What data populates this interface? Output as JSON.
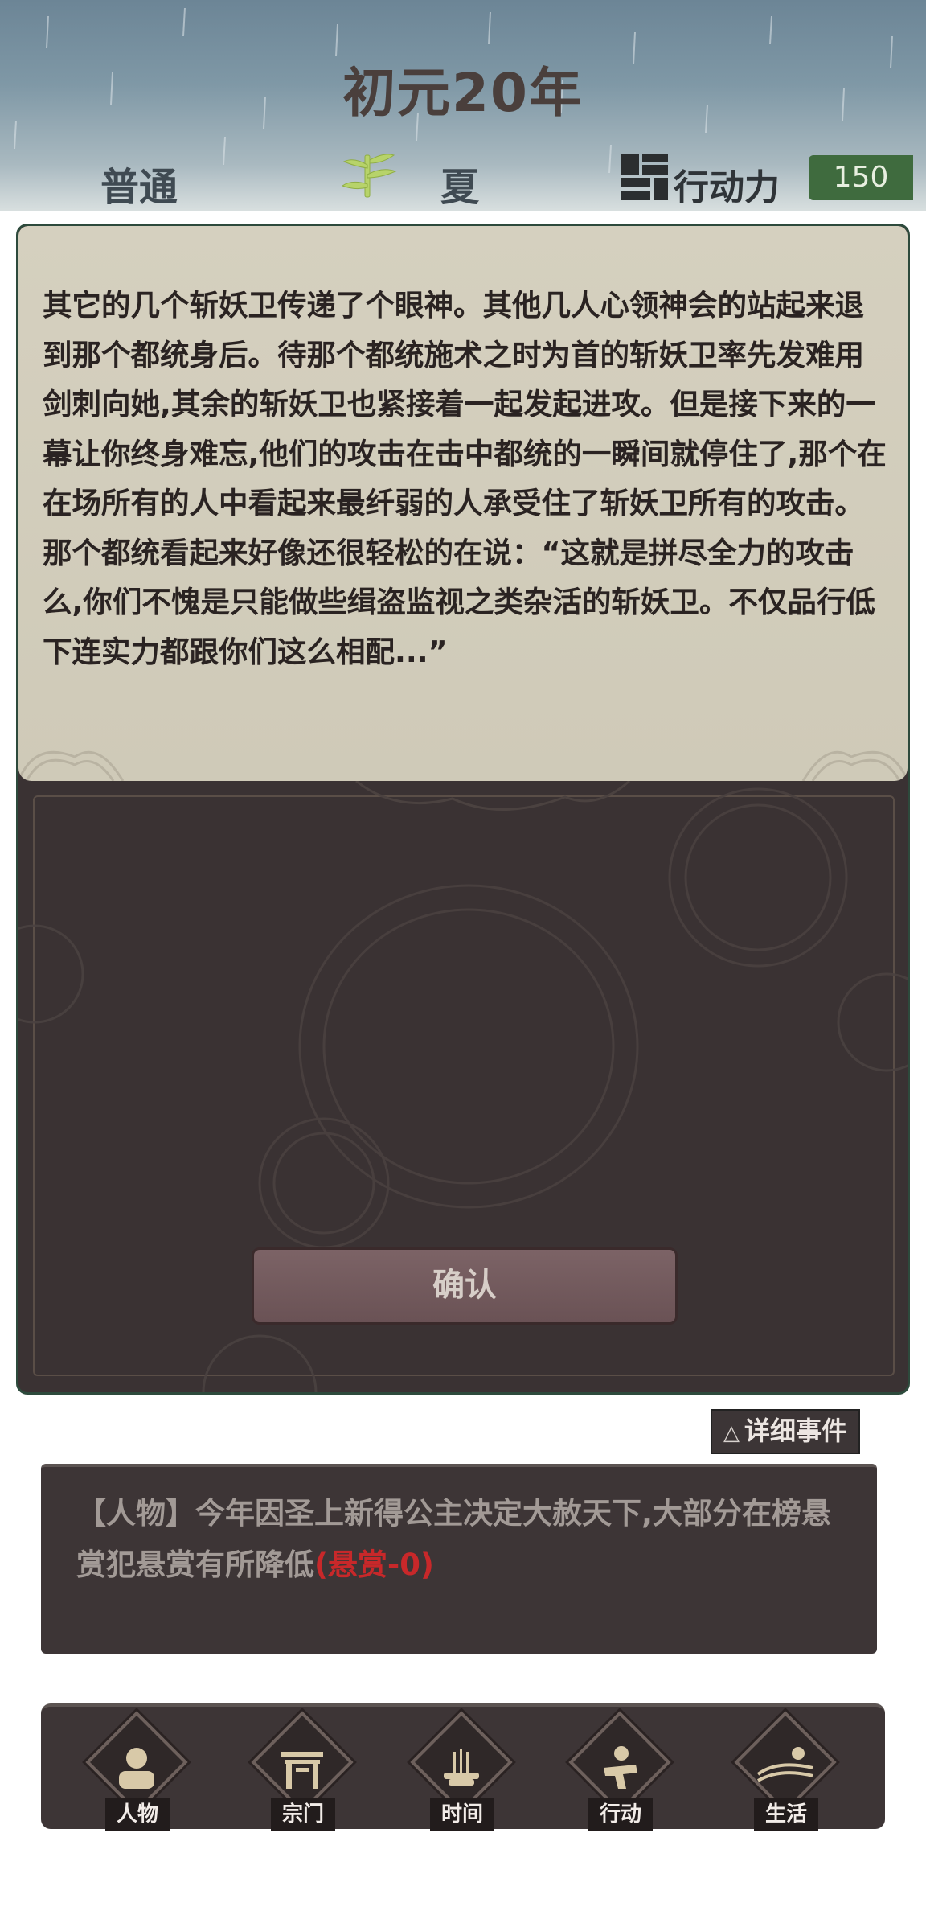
{
  "header": {
    "year": "初元20年",
    "difficulty": "普通",
    "season": "夏",
    "action_points_label": "行动力",
    "action_points_value": "150"
  },
  "story": {
    "text": "其它的几个斩妖卫传递了个眼神。其他几人心领神会的站起来退到那个都统身后。待那个都统施术之时为首的斩妖卫率先发难用剑刺向她,其余的斩妖卫也紧接着一起发起进攻。但是接下来的一幕让你终身难忘,他们的攻击在击中都统的一瞬间就停住了,那个在在场所有的人中看起来最纤弱的人承受住了斩妖卫所有的攻击。那个都统看起来好像还很轻松的在说：“这就是拼尽全力的攻击么,你们不愧是只能做些缉盗监视之类杂活的斩妖卫。不仅品行低下连实力都跟你们这么相配...”",
    "confirm_label": "确认"
  },
  "events": {
    "detail_button_label": "详细事件",
    "tag": "【人物】",
    "message": "今年因圣上新得公主决定大赦天下,大部分在榜悬赏犯悬赏有所降低",
    "highlight": "(悬赏-0)",
    "highlight_color": "#c8282a"
  },
  "nav": {
    "items": [
      {
        "label": "人物",
        "icon": "person-icon"
      },
      {
        "label": "宗门",
        "icon": "sect-gate-icon"
      },
      {
        "label": "时间",
        "icon": "incense-time-icon"
      },
      {
        "label": "行动",
        "icon": "action-figure-icon"
      },
      {
        "label": "生活",
        "icon": "life-landscape-icon"
      }
    ]
  },
  "colors": {
    "paper": "#d5d0bf",
    "panel": "#3a3233",
    "action_points_badge": "#3f6b3e"
  }
}
